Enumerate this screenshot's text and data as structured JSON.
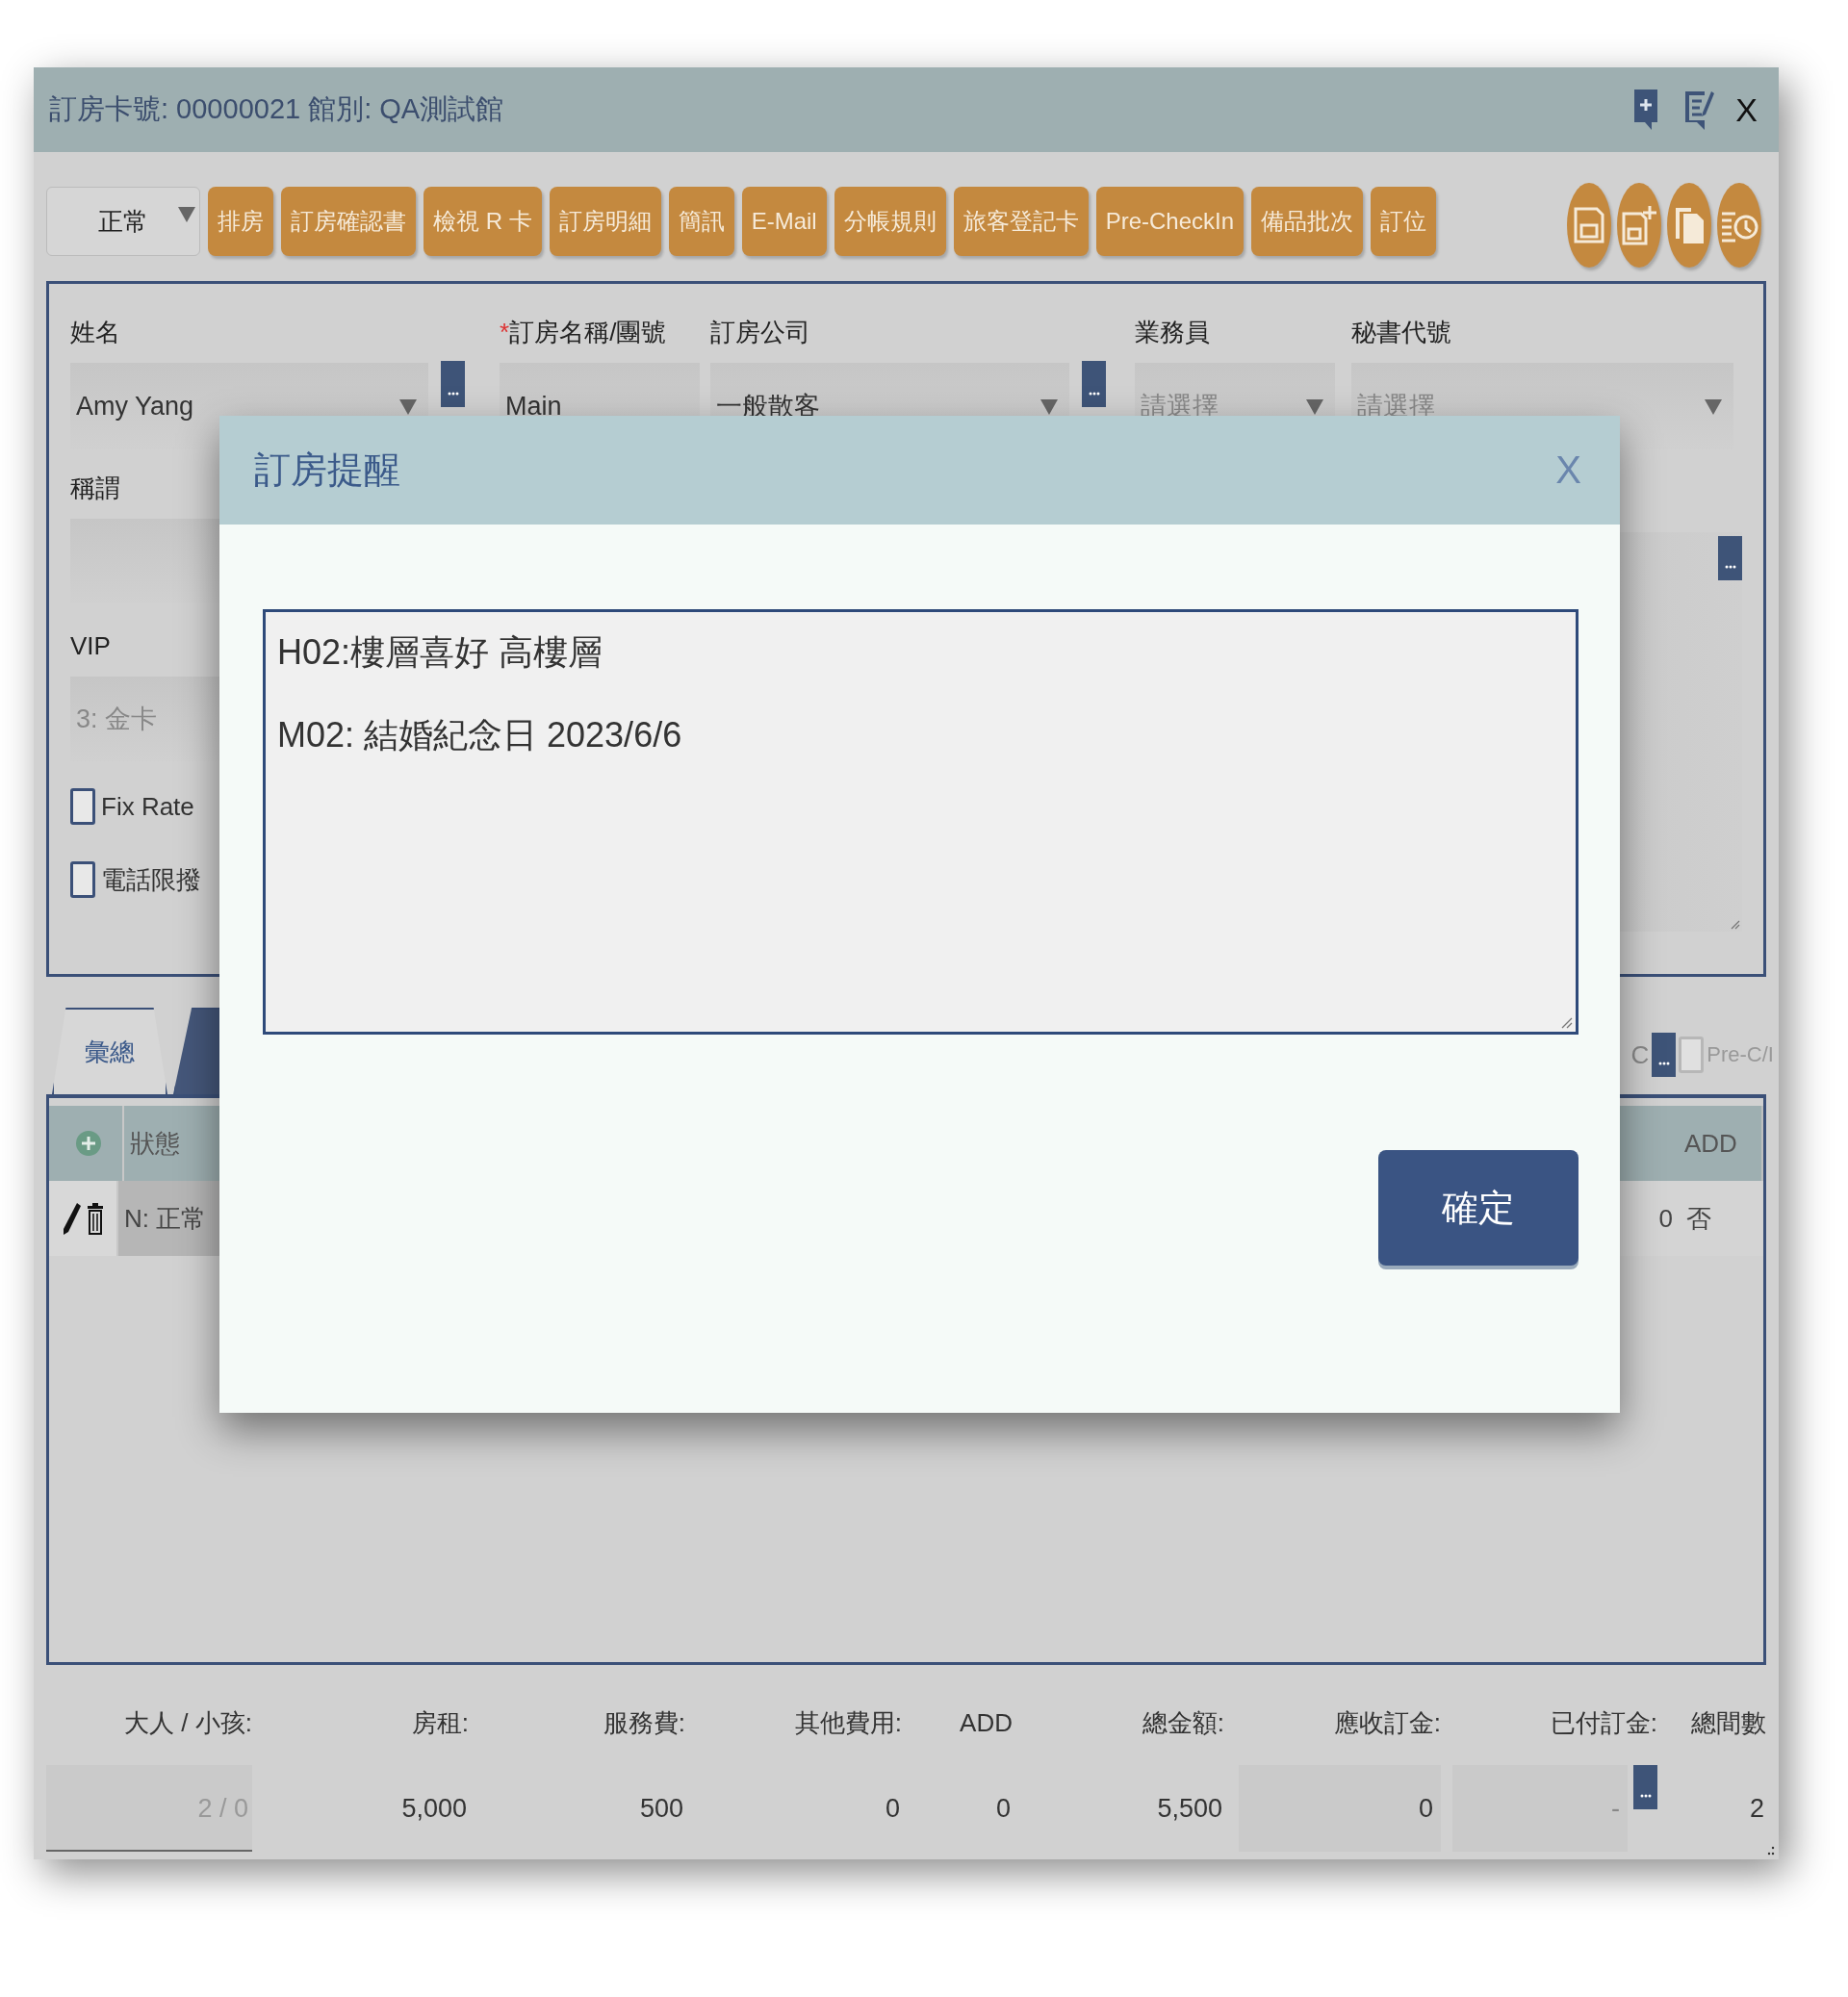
{
  "window": {
    "title": "訂房卡號: 00000021  館別: QA測試館",
    "close": "X"
  },
  "toolbar": {
    "status_select": "正常",
    "buttons": [
      "排房",
      "訂房確認書",
      "檢視 R 卡",
      "訂房明細",
      "簡訊",
      "E-Mail",
      "分帳規則",
      "旅客登記卡",
      "Pre-CheckIn",
      "備品批次",
      "訂位"
    ]
  },
  "form": {
    "top_fields": [
      {
        "label": "姓名",
        "value": "Amy Yang",
        "kind": "dropdown",
        "lookup": true
      },
      {
        "label": "訂房名稱/團號",
        "required_mark": "*",
        "value": "Main",
        "kind": "text",
        "lookup": false
      },
      {
        "label": "訂房公司",
        "value": "一般散客",
        "kind": "dropdown",
        "lookup": true
      },
      {
        "label": "業務員",
        "placeholder": "請選擇",
        "kind": "dropdown",
        "lookup": false
      },
      {
        "label": "秘書代號",
        "placeholder": "請選擇",
        "kind": "dropdown",
        "lookup": false
      }
    ],
    "title_field": {
      "label": "稱謂"
    },
    "vip_field": {
      "label": "VIP",
      "value": "3: 金卡"
    },
    "checkboxes": [
      {
        "label": "Fix Rate",
        "checked": false
      },
      {
        "label": "電話限撥",
        "checked": false
      }
    ]
  },
  "tabs": [
    {
      "label": "彙總",
      "selected": false
    },
    {
      "selected": true
    }
  ],
  "table_options": {
    "oc_label": "C",
    "pre_ci": {
      "label": "Pre-C/I",
      "checked": false
    }
  },
  "table": {
    "columns": [
      "狀態",
      "",
      "ADD"
    ],
    "rows": [
      {
        "cells": [
          "N: 正常",
          "0",
          "否"
        ]
      }
    ]
  },
  "totals": [
    {
      "label": "大人 / 小孩:",
      "value": "2 / 0",
      "kind": "underline"
    },
    {
      "label": "房租:",
      "value": "5,000",
      "kind": "plain"
    },
    {
      "label": "服務費:",
      "value": "500",
      "kind": "plain"
    },
    {
      "label": "其他費用:",
      "value": "0",
      "kind": "plain"
    },
    {
      "label": "ADD",
      "value": "0",
      "kind": "plain"
    },
    {
      "label": "總金額:",
      "value": "5,500",
      "kind": "plain"
    },
    {
      "label": "應收訂金:",
      "value": "0",
      "kind": "field"
    },
    {
      "label": "已付訂金:",
      "value": "-",
      "kind": "lookup"
    },
    {
      "label": "總間數",
      "value": "2",
      "kind": "plain"
    }
  ],
  "modal": {
    "title": "訂房提醒",
    "close": "X",
    "message_lines": [
      "H02:樓層喜好 高樓層",
      "M02: 結婚紀念日 2023/6/6"
    ],
    "ok": "確定"
  }
}
